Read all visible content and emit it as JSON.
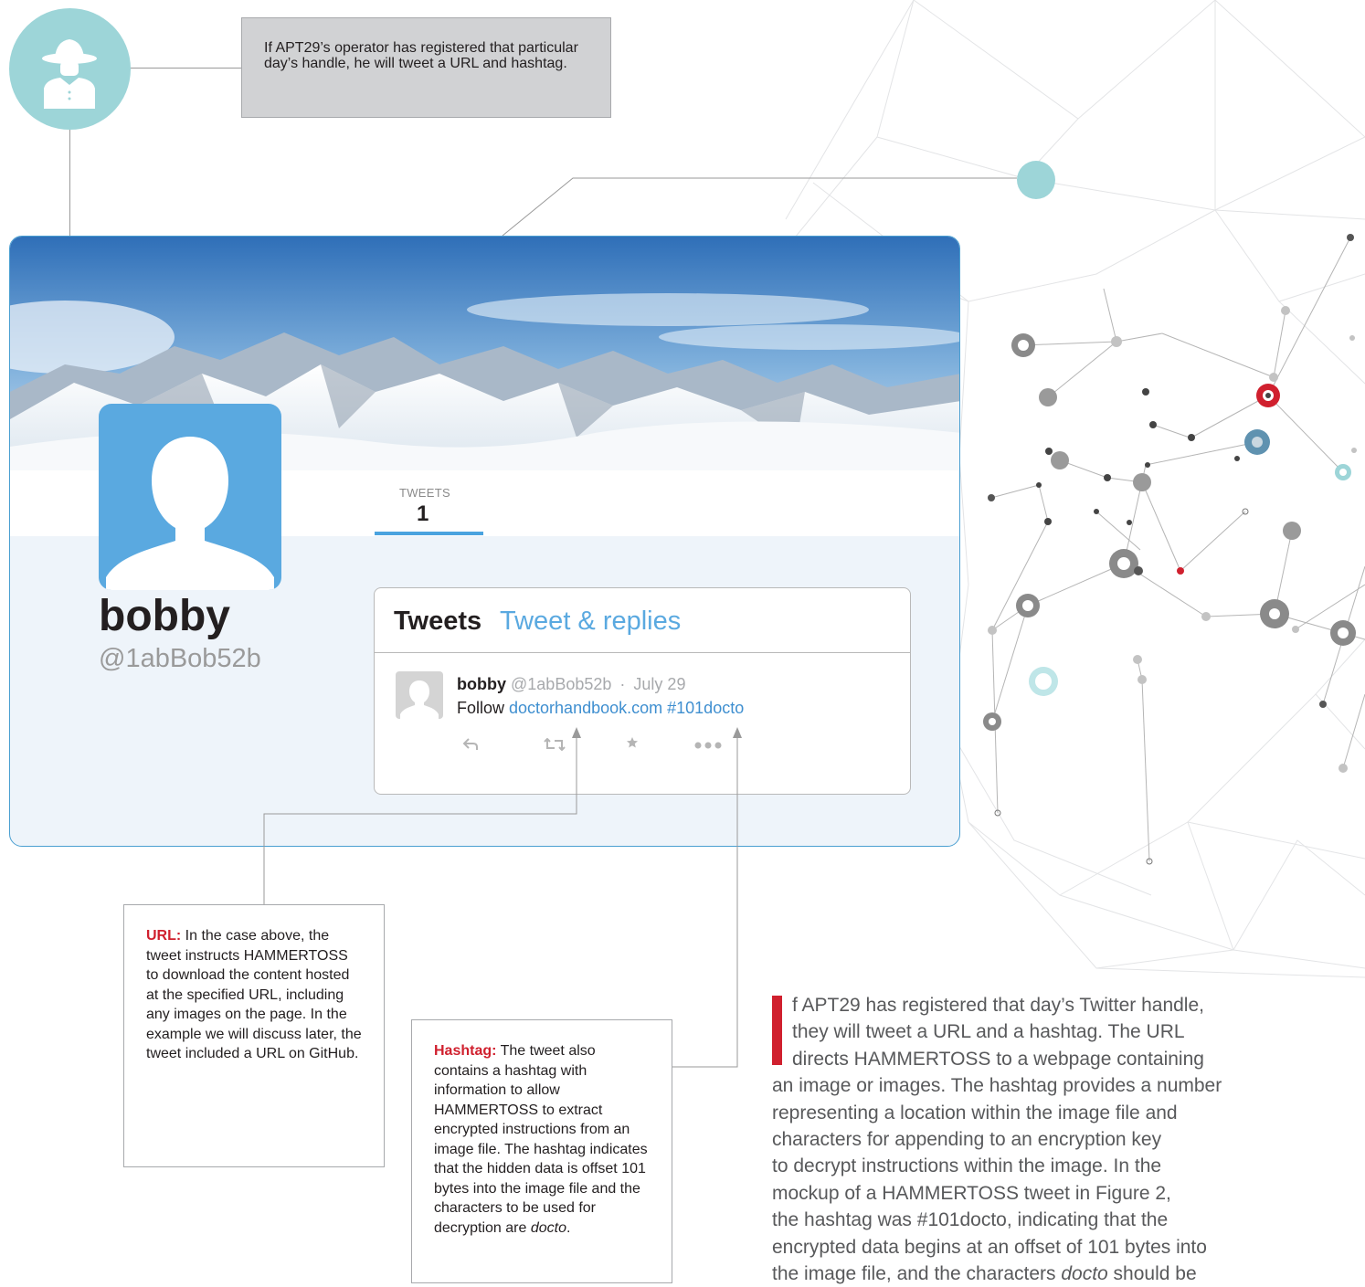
{
  "top_callout": {
    "text": "If APT29’s operator has registered that particular day’s handle, he will tweet a URL and hashtag."
  },
  "profile": {
    "stat_label": "TWEETS",
    "stat_value": "1",
    "display_name": "bobby",
    "handle": "@1abBob52b"
  },
  "tweets_panel": {
    "tab_tweets": "Tweets",
    "tab_replies": "Tweet & replies",
    "tweet": {
      "author": "bobby",
      "author_handle": "@1abBob52b",
      "separator": "·",
      "date": "July 29",
      "text_prefix": "Follow ",
      "url": "doctorhandbook.com",
      "hashtag": "#101docto",
      "actions": [
        "reply-icon",
        "retweet-icon",
        "favorite-icon",
        "more-icon"
      ]
    }
  },
  "url_callout": {
    "label": "URL:",
    "text": " In the case above, the tweet instructs HAMMERTOSS to download the content hosted at the specified URL, including any images on the page. In the example we will discuss later, the tweet included a URL on GitHub."
  },
  "hashtag_callout": {
    "label": "Hashtag:",
    "text": " The tweet also contains a hashtag with information to allow HAMMERTOSS to extract encrypted instructions from an image file. The hashtag indicates that the hidden data is offset 101 bytes into the image file and the characters to be used for decryption are ",
    "emph": "docto",
    "end": "."
  },
  "paragraph": {
    "lines": [
      "f APT29 has registered that day’s Twitter handle,",
      "they will tweet a URL and a hashtag. The URL",
      "directs HAMMERTOSS to a webpage containing",
      "an image or images. The hashtag provides a number",
      "representing a location within the image file and",
      "characters for appending to an encryption key",
      "to decrypt instructions within the image. In the",
      "mockup of a HAMMERTOSS tweet in Figure 2,",
      "the hashtag was #101docto, indicating that the",
      "encrypted data begins at an offset of 101 bytes into"
    ],
    "last_line_prefix": "the image file, and the characters ",
    "last_line_emph": "docto",
    "last_line_suffix": " should be"
  },
  "colors": {
    "accent_red": "#d0202e",
    "link_blue": "#3f8fd0",
    "teal": "#9dd5d8"
  }
}
